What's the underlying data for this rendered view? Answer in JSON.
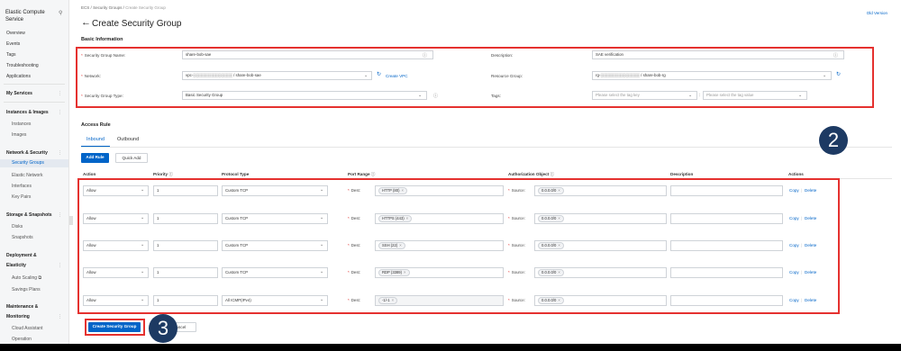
{
  "sidebar": {
    "title": "Elastic Compute Service",
    "search_icon": "search-icon",
    "items": [
      {
        "label": "Overview",
        "kind": "item"
      },
      {
        "label": "Events",
        "kind": "item"
      },
      {
        "label": "Tags",
        "kind": "item"
      },
      {
        "label": "Troubleshooting",
        "kind": "item"
      },
      {
        "label": "Applications",
        "kind": "item"
      },
      {
        "label": "My Services",
        "kind": "group"
      },
      {
        "label": "Instances & Images",
        "kind": "group"
      },
      {
        "label": "Instances",
        "kind": "sub"
      },
      {
        "label": "Images",
        "kind": "sub"
      },
      {
        "label": "Network & Security",
        "kind": "group"
      },
      {
        "label": "Security Groups",
        "kind": "active"
      },
      {
        "label": "Elastic Network",
        "kind": "sub"
      },
      {
        "label": "Interfaces",
        "kind": "sub"
      },
      {
        "label": "Key Pairs",
        "kind": "sub"
      },
      {
        "label": "Storage & Snapshots",
        "kind": "group"
      },
      {
        "label": "Disks",
        "kind": "sub"
      },
      {
        "label": "Snapshots",
        "kind": "sub"
      },
      {
        "label": "Deployment &",
        "kind": "group"
      },
      {
        "label": "Elasticity",
        "kind": "group"
      },
      {
        "label": "Auto Scaling",
        "kind": "sub"
      },
      {
        "label": "Savings Plans",
        "kind": "sub"
      },
      {
        "label": "Maintenance &",
        "kind": "group"
      },
      {
        "label": "Monitoring",
        "kind": "group"
      },
      {
        "label": "Cloud Assistant",
        "kind": "sub"
      },
      {
        "label": "Operation",
        "kind": "sub"
      }
    ]
  },
  "breadcrumb": {
    "items": [
      "ECS",
      "Security Groups",
      "Create Security Group"
    ],
    "separator": "/"
  },
  "header": {
    "title": "Create Security Group",
    "old_version": "Old Version",
    "back_icon": "arrow-left-icon"
  },
  "basic_info": {
    "section_title": "Basic Information",
    "security_group_name": {
      "label": "Security Group Name",
      "value": "share-bob-sae"
    },
    "description": {
      "label": "Description",
      "value": "SAE verification"
    },
    "network": {
      "label": "Network",
      "value": "vpc-░░░░░░░░░░░░░░ / share-bob-sae",
      "create_vpc": "Create VPC"
    },
    "resource_group": {
      "label": "Resource Group",
      "value": "rg-░░░░░░░░░░░░░░ / share-bob-rg"
    },
    "security_group_type": {
      "label": "Security Group Type",
      "value": "Basic Security Group"
    },
    "tags": {
      "label": "Tags",
      "key_placeholder": "Please select the tag key",
      "value_placeholder": "Please select the tag value"
    }
  },
  "access_rule": {
    "section_title": "Access Rule",
    "tabs": [
      "Inbound",
      "Outbound"
    ],
    "active_tab": "Inbound",
    "add_rule": "Add Rule",
    "quick_add": "Quick Add",
    "columns": [
      "Action",
      "Priority",
      "Protocol Type",
      "Port Range",
      "Authorization Object",
      "Description",
      "Actions"
    ],
    "dest_label": "Dest:",
    "source_label": "Source:",
    "copy": "Copy",
    "delete": "Delete",
    "rows": [
      {
        "action": "Allow",
        "priority": "1",
        "protocol": "Custom TCP",
        "port": "HTTP (80)",
        "source": "0.0.0.0/0",
        "description": ""
      },
      {
        "action": "Allow",
        "priority": "1",
        "protocol": "Custom TCP",
        "port": "HTTPS (443)",
        "source": "0.0.0.0/0",
        "description": ""
      },
      {
        "action": "Allow",
        "priority": "1",
        "protocol": "Custom TCP",
        "port": "SSH (22)",
        "source": "0.0.0.0/0",
        "description": ""
      },
      {
        "action": "Allow",
        "priority": "1",
        "protocol": "Custom TCP",
        "port": "RDP (3389)",
        "source": "0.0.0.0/0",
        "description": ""
      },
      {
        "action": "Allow",
        "priority": "1",
        "protocol": "All ICMP(IPv4)",
        "port": "-1/-1",
        "source": "0.0.0.0/0",
        "description": ""
      }
    ]
  },
  "footer": {
    "create_button": "Create Security Group",
    "cancel_button": "Cancel"
  },
  "annotations": {
    "step2": "2",
    "step3": "3"
  },
  "colors": {
    "accent": "#0064c8",
    "highlight": "#e5312f",
    "step_circle": "#1d3a63"
  }
}
